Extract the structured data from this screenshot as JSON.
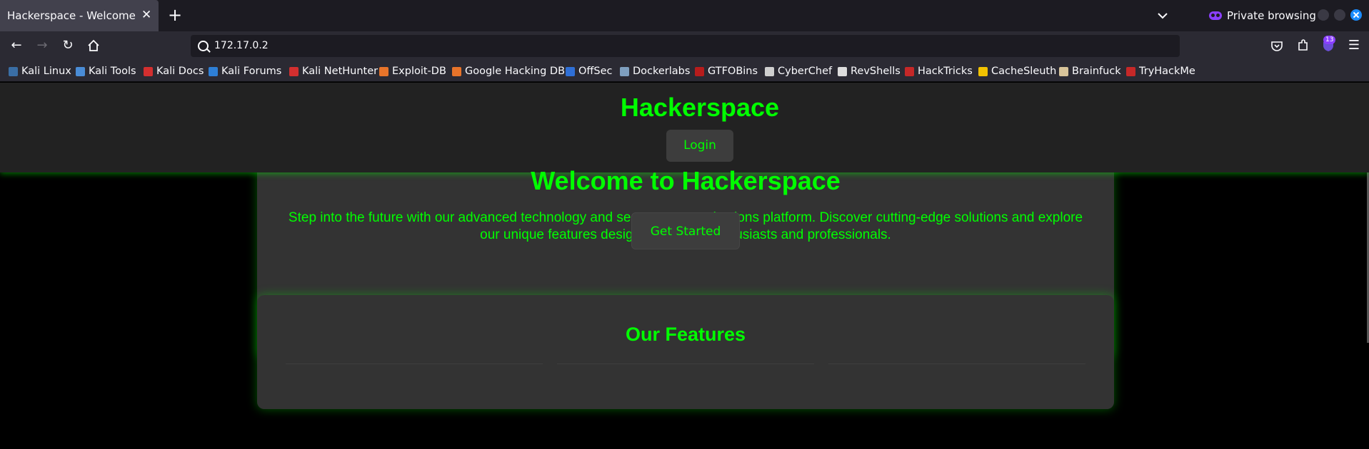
{
  "browser": {
    "tab_title": "Hackerspace - Welcome",
    "private_label": "Private browsing",
    "url": "172.17.0.2",
    "extensions_badge": "13",
    "bookmarks": [
      {
        "label": "Kali Linux",
        "color": "#3a6ea5"
      },
      {
        "label": "Kali Tools",
        "color": "#4a8cd6"
      },
      {
        "label": "Kali Docs",
        "color": "#d32f2f"
      },
      {
        "label": "Kali Forums",
        "color": "#2e7fd6"
      },
      {
        "label": "Kali NetHunter",
        "color": "#d32f2f"
      },
      {
        "label": "Exploit-DB",
        "color": "#e8742a"
      },
      {
        "label": "Google Hacking DB",
        "color": "#e8742a"
      },
      {
        "label": "OffSec",
        "color": "#2f6fd6"
      },
      {
        "label": "Dockerlabs",
        "color": "#7f9fbf"
      },
      {
        "label": "GTFOBins",
        "color": "#b71c1c"
      },
      {
        "label": "CyberChef",
        "color": "#cfcfcf"
      },
      {
        "label": "RevShells",
        "color": "#dddddd"
      },
      {
        "label": "HackTricks",
        "color": "#c62828"
      },
      {
        "label": "CacheSleuth",
        "color": "#f2c200"
      },
      {
        "label": "Brainfuck",
        "color": "#d8c49a"
      },
      {
        "label": "TryHackMe",
        "color": "#c62828"
      }
    ]
  },
  "site": {
    "title": "Hackerspace",
    "login_label": "Login",
    "accent_color": "#00ff00"
  },
  "hero": {
    "title": "Welcome to Hackerspace",
    "text": "Step into the future with our advanced technology and secure communications platform. Discover cutting-edge solutions and explore our unique features designed for tech enthusiasts and professionals.",
    "cta_label": "Get Started"
  },
  "features": {
    "title": "Our Features"
  }
}
